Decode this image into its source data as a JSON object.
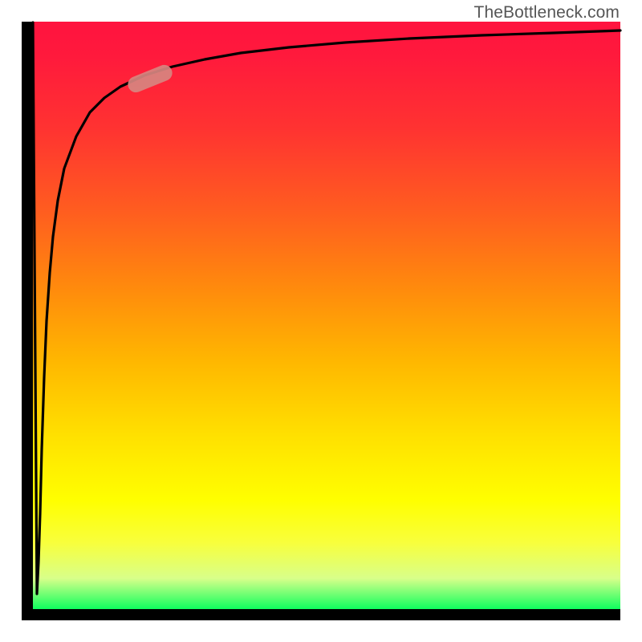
{
  "watermark": "TheBottleneck.com",
  "colors": {
    "axis": "#000000",
    "curve": "#000000",
    "highlight": "#d78580",
    "watermark_text": "#565656"
  },
  "chart_data": {
    "type": "line",
    "title": "",
    "xlabel": "",
    "ylabel": "",
    "xlim": [
      0,
      100
    ],
    "ylim": [
      0,
      100
    ],
    "grid": false,
    "series": [
      {
        "name": "curve",
        "x": [
          0,
          0.1,
          0.2,
          0.3,
          0.4,
          0.6,
          0.8,
          1.0,
          1.2,
          1.5,
          2.0,
          3.0,
          4.0,
          5.0,
          6.0,
          8.0,
          10.0,
          12.0,
          15.0,
          20.0,
          25.0,
          30.0,
          40.0,
          50.0,
          60.0,
          70.0,
          80.0,
          90.0,
          100.0
        ],
        "y": [
          100,
          5,
          10,
          20,
          30,
          45,
          55,
          62,
          68,
          73,
          78,
          83,
          85.5,
          87,
          88.2,
          89.8,
          90.8,
          91.5,
          92.2,
          93.0,
          93.6,
          94.0,
          94.7,
          95.2,
          95.6,
          95.9,
          96.2,
          96.4,
          96.6
        ]
      }
    ],
    "highlight": {
      "x_range_percent": [
        18,
        23
      ],
      "note": "short pill-shaped highlight on curve knee"
    },
    "gradient_background": {
      "top": "#ff133f",
      "middle": "#ffe000",
      "bottom": "#00ff5b"
    }
  }
}
